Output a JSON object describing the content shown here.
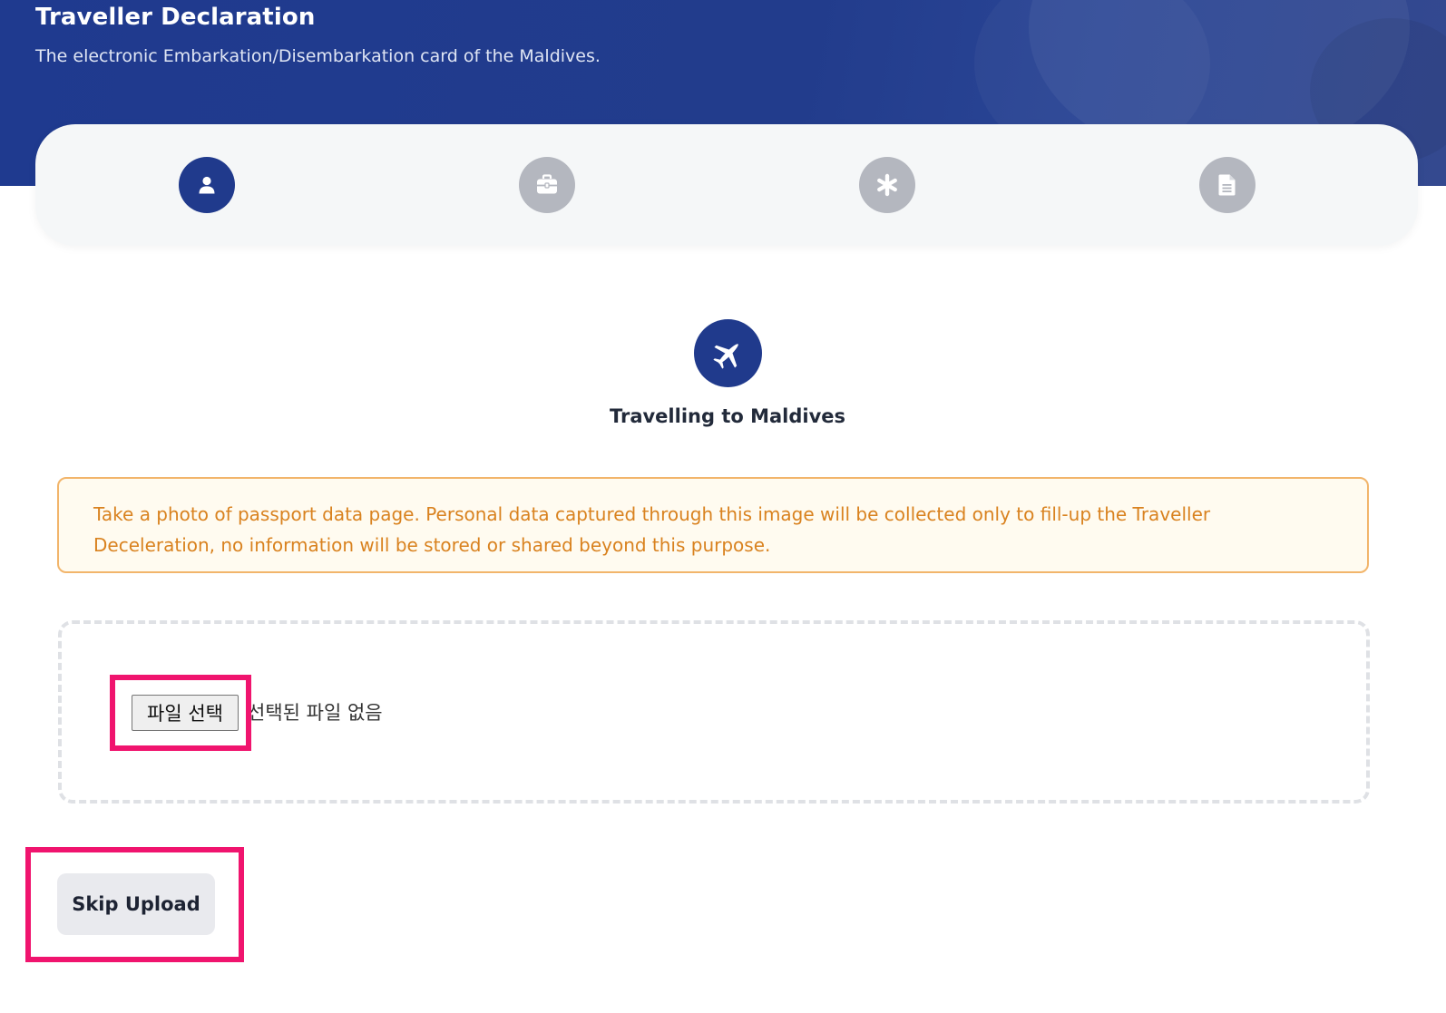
{
  "header": {
    "title": "Traveller Declaration",
    "subtitle": "The electronic Embarkation/Disembarkation card of the Maldives."
  },
  "stepper": {
    "steps": [
      {
        "icon": "user-icon",
        "state": "active"
      },
      {
        "icon": "briefcase-icon",
        "state": "inactive"
      },
      {
        "icon": "asterisk-icon",
        "state": "inactive"
      },
      {
        "icon": "document-icon",
        "state": "inactive"
      }
    ]
  },
  "section": {
    "icon": "airplane-icon",
    "title": "Travelling to Maldives"
  },
  "notice": {
    "text": "Take a photo of passport data page. Personal data captured through this image will be collected only to fill-up the Traveller Deceleration, no information will be stored or shared beyond this purpose."
  },
  "upload": {
    "choose_label": "파일 선택",
    "status_text": "선택된 파일 없음"
  },
  "actions": {
    "skip_label": "Skip Upload"
  },
  "colors": {
    "primary": "#203a8c",
    "inactive_step": "#b4b7bf",
    "notice_text": "#d9821f",
    "notice_border": "#f2b56b",
    "highlight": "#f0146e"
  }
}
